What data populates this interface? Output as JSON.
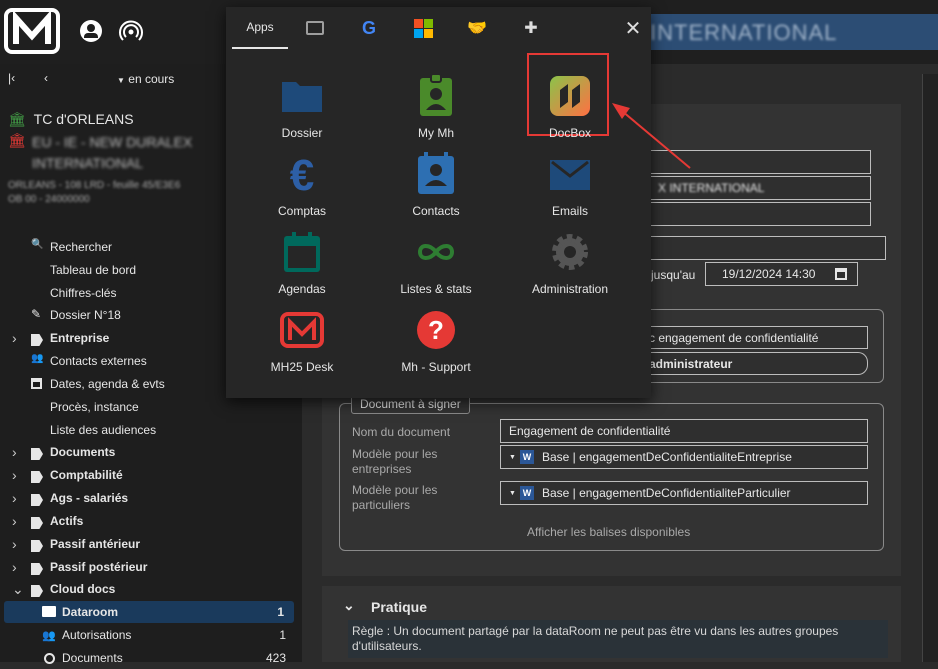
{
  "topbar": {
    "right_title": "INTERNATIONAL"
  },
  "sidebar": {
    "nav_state": "en cours",
    "court": "TC d'ORLEANS",
    "case_name": "EU - IE - NEW DURALEX",
    "case_name2": "INTERNATIONAL",
    "case_meta1": "ORLEANS - 108 LRD - feuille 45/E3E6",
    "case_meta2": "OB 00 - 24000000",
    "items": [
      {
        "label": "Rechercher",
        "bold": false,
        "chev": false,
        "icon": "search-icon"
      },
      {
        "label": "Tableau de bord",
        "bold": false,
        "chev": false,
        "icon": ""
      },
      {
        "label": "Chiffres-clés",
        "bold": false,
        "chev": false,
        "icon": ""
      },
      {
        "label": "Dossier N°18",
        "bold": false,
        "chev": false,
        "icon": "pencil-icon"
      },
      {
        "label": "Entreprise",
        "bold": true,
        "chev": true,
        "icon": "tag-icon"
      },
      {
        "label": "Contacts externes",
        "bold": false,
        "chev": false,
        "icon": "people-icon"
      },
      {
        "label": "Dates, agenda & evts",
        "bold": false,
        "chev": false,
        "icon": "calendar-icon"
      },
      {
        "label": "Procès, instance",
        "bold": false,
        "chev": false,
        "icon": ""
      },
      {
        "label": "Liste des audiences",
        "bold": false,
        "chev": false,
        "icon": ""
      },
      {
        "label": "Documents",
        "bold": true,
        "chev": true,
        "icon": "tag-icon"
      },
      {
        "label": "Comptabilité",
        "bold": true,
        "chev": true,
        "icon": "tag-icon"
      },
      {
        "label": "Ags - salariés",
        "bold": true,
        "chev": true,
        "icon": "tag-icon"
      },
      {
        "label": "Actifs",
        "bold": true,
        "chev": true,
        "icon": "tag-icon"
      },
      {
        "label": "Passif antérieur",
        "bold": true,
        "chev": true,
        "icon": "tag-icon"
      },
      {
        "label": "Passif postérieur",
        "bold": true,
        "chev": true,
        "icon": "tag-icon"
      },
      {
        "label": "Cloud docs",
        "bold": true,
        "chev": true,
        "icon": "tag-icon"
      }
    ],
    "dataroom": {
      "label": "Dataroom",
      "count": "1"
    },
    "autorisations": {
      "label": "Autorisations",
      "count": "1"
    },
    "documents": {
      "label": "Documents",
      "count": "423"
    }
  },
  "popup": {
    "tabs": {
      "apps": "Apps"
    },
    "apps": [
      {
        "name": "Dossier",
        "icon": "folder-icon",
        "color": "#1e4a7a"
      },
      {
        "name": "My Mh",
        "icon": "badge-icon",
        "color": "#4a8a2a"
      },
      {
        "name": "DocBox",
        "icon": "docbox-icon",
        "color": "#8bc34a"
      },
      {
        "name": "Comptas",
        "icon": "euro-icon",
        "color": "#2d5fa6"
      },
      {
        "name": "Contacts",
        "icon": "contact-card-icon",
        "color": "#2d6fb2"
      },
      {
        "name": "Emails",
        "icon": "mail-icon",
        "color": "#1e4a7a"
      },
      {
        "name": "Agendas",
        "icon": "calendar-icon",
        "color": "#00695c"
      },
      {
        "name": "Listes & stats",
        "icon": "infinity-icon",
        "color": "#2e7d32"
      },
      {
        "name": "Administration",
        "icon": "gear-icon",
        "color": "#555"
      },
      {
        "name": "MH25 Desk",
        "icon": "mh-logo-icon",
        "color": "#e53935"
      },
      {
        "name": "Mh - Support",
        "icon": "help-icon",
        "color": "#e53935"
      }
    ]
  },
  "form": {
    "field2": "X INTERNATIONAL",
    "jusqu_label": "jusqu'au",
    "date_value": "19/12/2024 14:30",
    "engagement_line": "c engagement de confidentialité",
    "admin_button": "administrateur",
    "doc_legend": "Document à signer",
    "nom_label": "Nom du document",
    "nom_value": "Engagement de confidentialité",
    "modele_ent_label": "Modèle pour les entreprises",
    "modele_ent_value": "Base | engagementDeConfidentialiteEntreprise",
    "modele_part_label": "Modèle pour les particuliers",
    "modele_part_value": "Base | engagementDeConfidentialiteParticulier",
    "balises_link": "Afficher les balises disponibles"
  },
  "pratique": {
    "title": "Pratique",
    "text": "Règle : Un document partagé par la dataRoom ne peut pas être vu dans les autres groupes d'utilisateurs."
  }
}
